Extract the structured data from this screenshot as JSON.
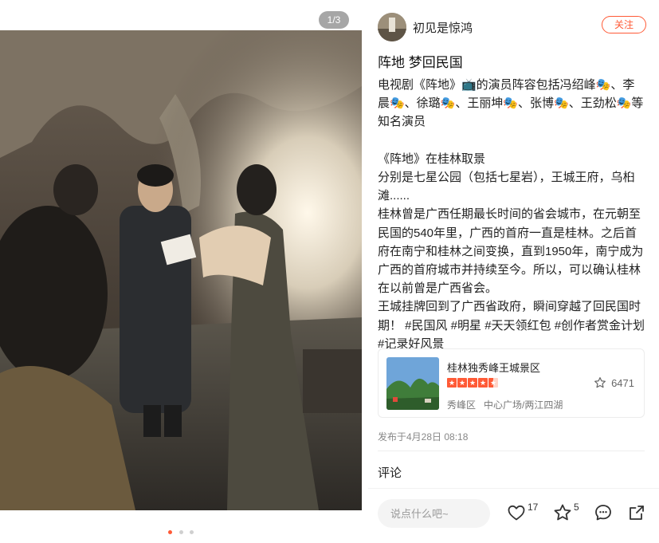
{
  "media": {
    "counter": "1/3",
    "dots": [
      true,
      false,
      false
    ]
  },
  "author": {
    "name": "初见是惊鸿",
    "follow_label": "关注"
  },
  "post": {
    "title": "阵地 梦回民国",
    "paragraphs": [
      "电视剧《阵地》📺的演员阵容包括冯绍峰🎭、李晨🎭、徐璐🎭、王丽坤🎭、张博🎭、王劲松🎭等知名演员",
      "",
      "《阵地》在桂林取景",
      "分别是七星公园（包括七星岩），王城王府，乌桕滩......",
      "桂林曾是广西任期最长时间的省会城市，在元朝至民国的540年里，广西的首府一直是桂林。之后首府在南宁和桂林之间变换，直到1950年，南宁成为广西的首府城市并持续至今。所以，可以确认桂林在以前曾是广西省会。",
      "王城挂牌回到了广西省政府，瞬间穿越了回民国时期！ #民国风 #明星 #天天领红包 #创作者赏金计划 #记录好风景"
    ]
  },
  "poi": {
    "name": "桂林独秀峰王城景区",
    "rating_stars": 4.5,
    "favorites": "6471",
    "district": "秀峰区",
    "area": "中心广场/两江四湖"
  },
  "published": "发布于4月28日 08:18",
  "comments": {
    "title": "评论",
    "input_placeholder": "说点什么吧~"
  },
  "actions": {
    "likes": "17",
    "stars": "5"
  },
  "colors": {
    "accent": "#ff5a36"
  }
}
